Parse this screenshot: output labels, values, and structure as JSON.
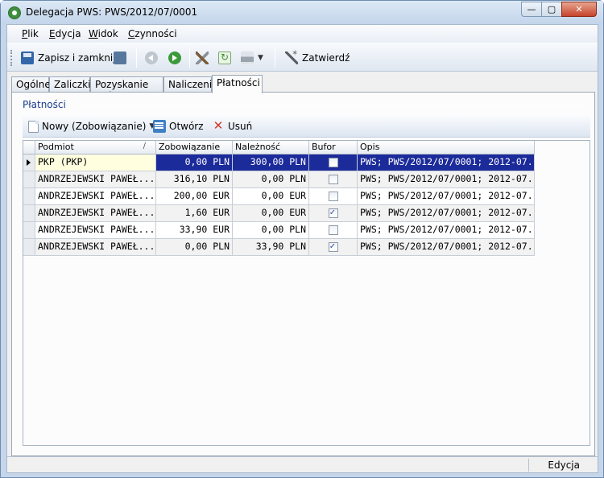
{
  "window": {
    "title": "Delegacja PWS: PWS/2012/07/0001",
    "min_glyph": "—",
    "max_glyph": "▢",
    "close_glyph": "✕"
  },
  "menu": {
    "items": [
      {
        "accel": "P",
        "rest": "lik"
      },
      {
        "accel": "E",
        "rest": "dycja"
      },
      {
        "accel": "W",
        "rest": "idok"
      },
      {
        "accel": "C",
        "rest": "zynności"
      }
    ]
  },
  "toolbar": {
    "save_close_label": "Zapisz i zamknij",
    "approve_label": "Zatwierdź",
    "icons": [
      "floppy-icon",
      "save-as-icon",
      "back-icon",
      "forward-icon",
      "tools-icon",
      "refresh-icon",
      "printer-icon",
      "wand-icon"
    ]
  },
  "tabs": [
    {
      "label": "Ogólne"
    },
    {
      "label": "Zaliczki"
    },
    {
      "label": "Pozyskanie walut"
    },
    {
      "label": "Naliczenia"
    },
    {
      "label": "Płatności",
      "active": true
    }
  ],
  "payments": {
    "group_label": "Płatności",
    "new_label": "Nowy (Zobowiązanie)",
    "open_label": "Otwórz",
    "delete_label": "Usuń",
    "columns": [
      "Podmiot",
      "Zobowiązanie",
      "Należność",
      "Bufor",
      "Opis"
    ],
    "rows": [
      {
        "podmiot": "PKP (PKP)",
        "zobowiazanie": "0,00 PLN",
        "naleznosc": "300,00 PLN",
        "bufor": false,
        "opis": "PWS; PWS/2012/07/0001; 2012-07..."
      },
      {
        "podmiot": "ANDRZEJEWSKI PAWEŁ...",
        "zobowiazanie": "316,10 PLN",
        "naleznosc": "0,00 PLN",
        "bufor": false,
        "opis": "PWS; PWS/2012/07/0001; 2012-07..."
      },
      {
        "podmiot": "ANDRZEJEWSKI PAWEŁ...",
        "zobowiazanie": "200,00 EUR",
        "naleznosc": "0,00 EUR",
        "bufor": false,
        "opis": "PWS; PWS/2012/07/0001; 2012-07..."
      },
      {
        "podmiot": "ANDRZEJEWSKI PAWEŁ...",
        "zobowiazanie": "1,60 EUR",
        "naleznosc": "0,00 EUR",
        "bufor": true,
        "opis": "PWS; PWS/2012/07/0001; 2012-07..."
      },
      {
        "podmiot": "ANDRZEJEWSKI PAWEŁ...",
        "zobowiazanie": "33,90 EUR",
        "naleznosc": "0,00 PLN",
        "bufor": false,
        "opis": "PWS; PWS/2012/07/0001; 2012-07..."
      },
      {
        "podmiot": "ANDRZEJEWSKI PAWEŁ...",
        "zobowiazanie": "0,00 PLN",
        "naleznosc": "33,90 PLN",
        "bufor": true,
        "opis": "PWS; PWS/2012/07/0001; 2012-07..."
      }
    ]
  },
  "status": {
    "mode": "Edycja"
  }
}
